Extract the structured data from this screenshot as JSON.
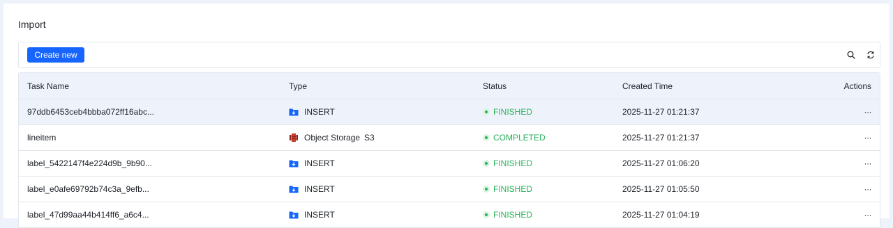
{
  "page": {
    "title": "Import"
  },
  "toolbar": {
    "create_label": "Create new",
    "search_icon": "search-icon",
    "refresh_icon": "refresh-icon"
  },
  "colors": {
    "accent": "#1665ff",
    "success": "#27b15a",
    "header_bg": "#eef3fb"
  },
  "table": {
    "headers": {
      "task_name": "Task Name",
      "type": "Type",
      "status": "Status",
      "created_time": "Created Time",
      "actions": "Actions"
    },
    "rows": [
      {
        "name": "97ddb6453ceb4bbba072ff16abc...",
        "type": "INSERT",
        "type_sub": "",
        "type_icon": "folder-download-icon",
        "status": "FINISHED",
        "created": "2025-11-27 01:21:37",
        "more": "···"
      },
      {
        "name": "lineitem",
        "type": "Object Storage",
        "type_sub": "S3",
        "type_icon": "s3-icon",
        "status": "COMPLETED",
        "created": "2025-11-27 01:21:37",
        "more": "···"
      },
      {
        "name": "label_5422147f4e224d9b_9b90...",
        "type": "INSERT",
        "type_sub": "",
        "type_icon": "folder-download-icon",
        "status": "FINISHED",
        "created": "2025-11-27 01:06:20",
        "more": "···"
      },
      {
        "name": "label_e0afe69792b74c3a_9efb...",
        "type": "INSERT",
        "type_sub": "",
        "type_icon": "folder-download-icon",
        "status": "FINISHED",
        "created": "2025-11-27 01:05:50",
        "more": "···"
      },
      {
        "name": "label_47d99aa44b414ff6_a6c4...",
        "type": "INSERT",
        "type_sub": "",
        "type_icon": "folder-download-icon",
        "status": "FINISHED",
        "created": "2025-11-27 01:04:19",
        "more": "···"
      }
    ]
  }
}
